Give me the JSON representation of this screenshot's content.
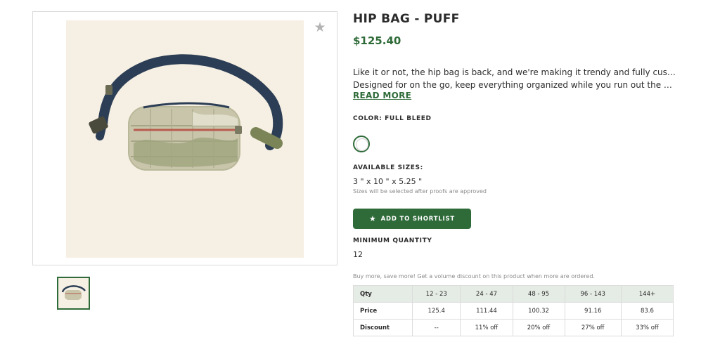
{
  "product": {
    "title": "HIP BAG - PUFF",
    "price": "$125.40",
    "description_line1": "Like it or not, the hip bag is back, and we're making it trendy and fully custom.",
    "description_line2": "Designed for on the go, keep everything organized while you run out the door on yo...",
    "read_more": "READ MORE"
  },
  "color": {
    "label": "COLOR: FULL BLEED",
    "selected_swatch": "#ffffff"
  },
  "sizes": {
    "label": "AVAILABLE SIZES:",
    "value": "3 \" x 10 \" x 5.25 \"",
    "note": "Sizes will be selected after proofs are approved"
  },
  "shortlist_button": {
    "label": "ADD TO SHORTLIST",
    "icon": "star-icon"
  },
  "minimum_quantity": {
    "label": "MINIMUM QUANTITY",
    "value": "12"
  },
  "volume_note": "Buy more, save more! Get a volume discount on this product when more are ordered.",
  "pricing_table": {
    "header": [
      "Qty",
      "12 - 23",
      "24 - 47",
      "48 - 95",
      "96 - 143",
      "144+"
    ],
    "rows": [
      [
        "Price",
        "125.4",
        "111.44",
        "100.32",
        "91.16",
        "83.6"
      ],
      [
        "Discount",
        "--",
        "11% off",
        "20% off",
        "27% off",
        "33% off"
      ]
    ]
  },
  "colors": {
    "accent": "#2f6b39",
    "image_background": "#f6efe3",
    "table_header": "#e5ebe5"
  }
}
